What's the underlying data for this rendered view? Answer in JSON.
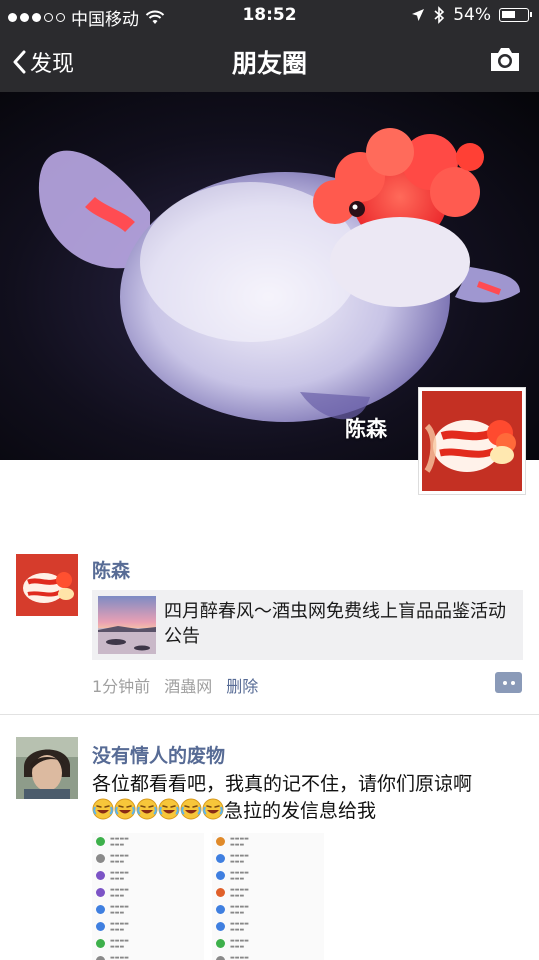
{
  "status_bar": {
    "carrier": "中国移动",
    "time": "18:52",
    "battery": "54%",
    "battery_level": 0.54
  },
  "nav": {
    "back_label": "发现",
    "title": "朋友圈",
    "camera_icon": "camera-icon"
  },
  "cover": {
    "owner_name": "陈森"
  },
  "posts": [
    {
      "author": "陈森",
      "link_title": "四月醉春风～酒虫网免费线上盲品品鉴活动公告",
      "time": "1分钟前",
      "source": "酒蟲网",
      "delete_label": "删除"
    },
    {
      "author": "没有情人的废物",
      "text_before": "各位都看看吧，我真的记不住，请你们原谅啊",
      "emoji_count": 6,
      "text_after": "急拉的发信息给我"
    }
  ],
  "colors": {
    "bar_bg": "#2b2b2e",
    "name_blue": "#576b95",
    "link_bg": "#f0f0f2"
  }
}
